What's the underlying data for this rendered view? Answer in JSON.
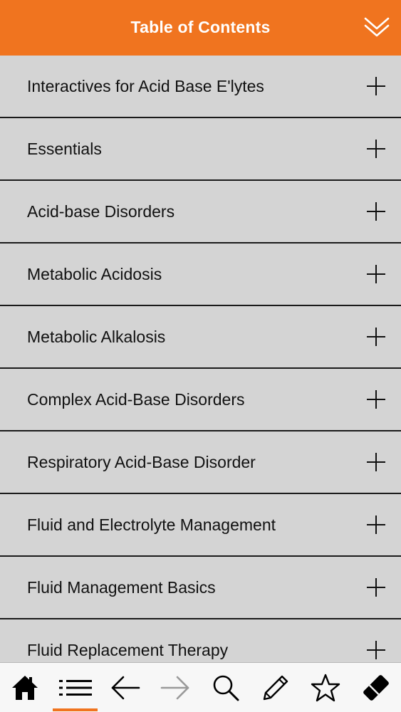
{
  "header": {
    "title": "Table of Contents",
    "collapse_icon": "double-chevron-down-icon"
  },
  "toc": {
    "items": [
      {
        "label": "Interactives for Acid Base E'lytes"
      },
      {
        "label": "Essentials"
      },
      {
        "label": "Acid-base Disorders"
      },
      {
        "label": "Metabolic Acidosis"
      },
      {
        "label": "Metabolic Alkalosis"
      },
      {
        "label": "Complex Acid-Base Disorders"
      },
      {
        "label": "Respiratory Acid-Base Disorder"
      },
      {
        "label": "Fluid and Electrolyte Management"
      },
      {
        "label": "Fluid Management Basics"
      },
      {
        "label": "Fluid Replacement Therapy"
      }
    ],
    "expand_icon": "plus-icon"
  },
  "tabbar": {
    "tabs": [
      {
        "icon": "home-icon",
        "active": false
      },
      {
        "icon": "list-icon",
        "active": true
      },
      {
        "icon": "arrow-left-icon",
        "active": false
      },
      {
        "icon": "arrow-right-icon",
        "active": false,
        "disabled": true
      },
      {
        "icon": "search-icon",
        "active": false
      },
      {
        "icon": "pencil-icon",
        "active": false
      },
      {
        "icon": "star-icon",
        "active": false
      },
      {
        "icon": "eraser-icon",
        "active": false
      }
    ]
  },
  "colors": {
    "accent": "#f0741f",
    "list_background": "#d4d4d4",
    "text": "#111111"
  }
}
